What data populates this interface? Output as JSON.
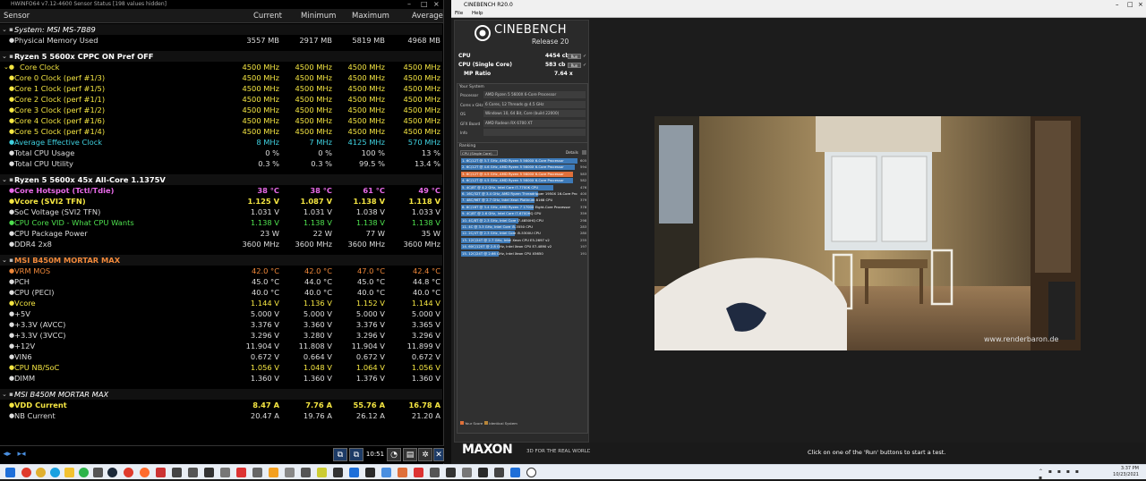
{
  "hwinfo": {
    "title": "HWiNFO64 v7.12-4600 Sensor Status [198 values hidden]",
    "columns": {
      "sensor": "Sensor",
      "current": "Current",
      "minimum": "Minimum",
      "maximum": "Maximum",
      "average": "Average"
    },
    "rows": [
      {
        "type": "group",
        "label": "System: MSI MS-7B89",
        "italic": true,
        "color": "#ffffff"
      },
      {
        "type": "row",
        "label": "Physical Memory Used",
        "cur": "3557 MB",
        "min": "2917 MB",
        "max": "5819 MB",
        "avg": "4968 MB",
        "color": "#dddddd"
      },
      {
        "type": "sep"
      },
      {
        "type": "group",
        "label": "Ryzen 5 5600x CPPC ON Pref OFF",
        "italic": false,
        "color": "#ffffff"
      },
      {
        "type": "row",
        "label": "Core Clock",
        "cur": "4500 MHz",
        "min": "4500 MHz",
        "max": "4500 MHz",
        "avg": "4500 MHz",
        "color": "#f5e642",
        "sub": true
      },
      {
        "type": "row",
        "label": "Core 0 Clock (perf #1/3)",
        "cur": "4500 MHz",
        "min": "4500 MHz",
        "max": "4500 MHz",
        "avg": "4500 MHz",
        "color": "#f5e642"
      },
      {
        "type": "row",
        "label": "Core 1 Clock (perf #1/5)",
        "cur": "4500 MHz",
        "min": "4500 MHz",
        "max": "4500 MHz",
        "avg": "4500 MHz",
        "color": "#f5e642"
      },
      {
        "type": "row",
        "label": "Core 2 Clock (perf #1/1)",
        "cur": "4500 MHz",
        "min": "4500 MHz",
        "max": "4500 MHz",
        "avg": "4500 MHz",
        "color": "#f5e642"
      },
      {
        "type": "row",
        "label": "Core 3 Clock (perf #1/2)",
        "cur": "4500 MHz",
        "min": "4500 MHz",
        "max": "4500 MHz",
        "avg": "4500 MHz",
        "color": "#f5e642"
      },
      {
        "type": "row",
        "label": "Core 4 Clock (perf #1/6)",
        "cur": "4500 MHz",
        "min": "4500 MHz",
        "max": "4500 MHz",
        "avg": "4500 MHz",
        "color": "#f5e642"
      },
      {
        "type": "row",
        "label": "Core 5 Clock (perf #1/4)",
        "cur": "4500 MHz",
        "min": "4500 MHz",
        "max": "4500 MHz",
        "avg": "4500 MHz",
        "color": "#f5e642"
      },
      {
        "type": "row",
        "label": "Average Effective Clock",
        "cur": "8 MHz",
        "min": "7 MHz",
        "max": "4125 MHz",
        "avg": "570 MHz",
        "color": "#3fd1e0"
      },
      {
        "type": "row",
        "label": "Total CPU Usage",
        "cur": "0 %",
        "min": "0 %",
        "max": "100 %",
        "avg": "13 %",
        "color": "#dddddd"
      },
      {
        "type": "row",
        "label": "Total CPU Utility",
        "cur": "0.3 %",
        "min": "0.3 %",
        "max": "99.5 %",
        "avg": "13.4 %",
        "color": "#dddddd"
      },
      {
        "type": "sep"
      },
      {
        "type": "group",
        "label": "Ryzen 5 5600x 45x All-Core 1.1375V",
        "italic": false,
        "color": "#ffffff"
      },
      {
        "type": "row",
        "label": "Core Hotspot (Tctl/Tdie)",
        "cur": "38 °C",
        "min": "38 °C",
        "max": "61 °C",
        "avg": "49 °C",
        "color": "#e86ae8",
        "bold": true
      },
      {
        "type": "row",
        "label": "Vcore (SVI2 TFN)",
        "cur": "1.125 V",
        "min": "1.087 V",
        "max": "1.138 V",
        "avg": "1.118 V",
        "color": "#f5e642",
        "bold": true
      },
      {
        "type": "row",
        "label": "SoC Voltage (SVI2 TFN)",
        "cur": "1.031 V",
        "min": "1.031 V",
        "max": "1.038 V",
        "avg": "1.033 V",
        "color": "#dddddd"
      },
      {
        "type": "row",
        "label": "CPU Core VID - What CPU Wants",
        "cur": "1.138 V",
        "min": "1.138 V",
        "max": "1.138 V",
        "avg": "1.138 V",
        "color": "#4ee04e"
      },
      {
        "type": "row",
        "label": "CPU Package Power",
        "cur": "23 W",
        "min": "22 W",
        "max": "77 W",
        "avg": "35 W",
        "color": "#dddddd"
      },
      {
        "type": "row",
        "label": "DDR4 2x8",
        "cur": "3600 MHz",
        "min": "3600 MHz",
        "max": "3600 MHz",
        "avg": "3600 MHz",
        "color": "#dddddd"
      },
      {
        "type": "sep"
      },
      {
        "type": "group",
        "label": "MSI B450M MORTAR MAX",
        "italic": false,
        "color": "#f0883a"
      },
      {
        "type": "row",
        "label": "VRM MOS",
        "cur": "42.0 °C",
        "min": "42.0 °C",
        "max": "47.0 °C",
        "avg": "42.4 °C",
        "color": "#f0883a"
      },
      {
        "type": "row",
        "label": "PCH",
        "cur": "45.0 °C",
        "min": "44.0 °C",
        "max": "45.0 °C",
        "avg": "44.8 °C",
        "color": "#dddddd"
      },
      {
        "type": "row",
        "label": "CPU (PECI)",
        "cur": "40.0 °C",
        "min": "40.0 °C",
        "max": "40.0 °C",
        "avg": "40.0 °C",
        "color": "#dddddd"
      },
      {
        "type": "row",
        "label": "Vcore",
        "cur": "1.144 V",
        "min": "1.136 V",
        "max": "1.152 V",
        "avg": "1.144 V",
        "color": "#f5e642"
      },
      {
        "type": "row",
        "label": "+5V",
        "cur": "5.000 V",
        "min": "5.000 V",
        "max": "5.000 V",
        "avg": "5.000 V",
        "color": "#dddddd"
      },
      {
        "type": "row",
        "label": "+3.3V (AVCC)",
        "cur": "3.376 V",
        "min": "3.360 V",
        "max": "3.376 V",
        "avg": "3.365 V",
        "color": "#dddddd"
      },
      {
        "type": "row",
        "label": "+3.3V (3VCC)",
        "cur": "3.296 V",
        "min": "3.280 V",
        "max": "3.296 V",
        "avg": "3.296 V",
        "color": "#dddddd"
      },
      {
        "type": "row",
        "label": "+12V",
        "cur": "11.904 V",
        "min": "11.808 V",
        "max": "11.904 V",
        "avg": "11.899 V",
        "color": "#dddddd"
      },
      {
        "type": "row",
        "label": "VIN6",
        "cur": "0.672 V",
        "min": "0.664 V",
        "max": "0.672 V",
        "avg": "0.672 V",
        "color": "#dddddd"
      },
      {
        "type": "row",
        "label": "CPU NB/SoC",
        "cur": "1.056 V",
        "min": "1.048 V",
        "max": "1.064 V",
        "avg": "1.056 V",
        "color": "#f5e642"
      },
      {
        "type": "row",
        "label": "DIMM",
        "cur": "1.360 V",
        "min": "1.360 V",
        "max": "1.376 V",
        "avg": "1.360 V",
        "color": "#dddddd"
      },
      {
        "type": "sep"
      },
      {
        "type": "group",
        "label": "MSI B450M MORTAR MAX",
        "italic": true,
        "color": "#ffffff"
      },
      {
        "type": "row",
        "label": "VDD Current",
        "cur": "8.47 A",
        "min": "7.76 A",
        "max": "55.76 A",
        "avg": "16.78 A",
        "color": "#f5e642",
        "bold": true
      },
      {
        "type": "row",
        "label": "NB Current",
        "cur": "20.47 A",
        "min": "19.76 A",
        "max": "26.12 A",
        "avg": "21.20 A",
        "color": "#dddddd"
      }
    ],
    "toolbar": {
      "time": "10:51"
    }
  },
  "cinebench": {
    "title": "CINEBENCH R20.0",
    "menu": [
      "File",
      "Help"
    ],
    "logo_title": "CINEBENCH",
    "logo_sub": "Release 20",
    "scores": [
      {
        "label": "CPU",
        "value": "4454 cb",
        "btn": "Run"
      },
      {
        "label": "CPU (Single Core)",
        "value": "583 cb",
        "btn": "Run"
      },
      {
        "label": "MP Ratio",
        "value": "7.64 x",
        "btn": ""
      }
    ],
    "system_header": "Your System",
    "system": [
      {
        "label": "Processor",
        "value": "AMD Ryzen 5 5600X 6-Core Processor"
      },
      {
        "label": "Cores x GHz",
        "value": "6 Cores, 12 Threads @ 4.5 GHz"
      },
      {
        "label": "OS",
        "value": "Windows 10, 64 Bit, Core (build 22000)"
      },
      {
        "label": "GFX Board",
        "value": "AMD Radeon RX 6700 XT"
      },
      {
        "label": "Info",
        "value": ""
      }
    ],
    "ranking_header": "Ranking",
    "ranking_select": "CPU (Single Core)",
    "ranking_details": "Details",
    "ranking": [
      {
        "label": "1. 6C/12T @ 3.7 GHz, AMD Ryzen 5 5600X 6-Core Processor",
        "score": "605",
        "fill": 1.0,
        "mine": false
      },
      {
        "label": "2. 6C/12T @ 4.6 GHz, AMD Ryzen 5 5600X 6-Core Processor",
        "score": "594",
        "fill": 0.98,
        "mine": false
      },
      {
        "label": "3. 6C/12T @ 4.5 GHz, AMD Ryzen 5 5600X 6-Core Processor",
        "score": "583",
        "fill": 0.96,
        "mine": true
      },
      {
        "label": "4. 6C/12T @ 4.5 GHz, AMD Ryzen 5 5600X 6-Core Processor",
        "score": "582",
        "fill": 0.96,
        "mine": false
      },
      {
        "label": "5. 4C/8T @ 4.2 GHz, Intel Core i7-7700K CPU",
        "score": "476",
        "fill": 0.79,
        "mine": false
      },
      {
        "label": "6. 16C/32T @ 3.4 GHz, AMD Ryzen Threadripper 1950X 16-Core Pro",
        "score": "400",
        "fill": 0.66,
        "mine": false
      },
      {
        "label": "7. 48C/96T @ 2.7 GHz, Intel Xeon Platinum 8168 CPU",
        "score": "379",
        "fill": 0.63,
        "mine": false
      },
      {
        "label": "8. 8C/16T @ 3.4 GHz, AMD Ryzen 7 1700X Eight-Core Processor",
        "score": "378",
        "fill": 0.62,
        "mine": false
      },
      {
        "label": "9. 4C/8T @ 2.6 GHz, Intel Core i7-6700HQ CPU",
        "score": "359",
        "fill": 0.59,
        "mine": false
      },
      {
        "label": "10. 4C/8T @ 2.3 GHz, Intel Core i7-4850HQ CPU",
        "score": "298",
        "fill": 0.49,
        "mine": false
      },
      {
        "label": "11. 4C @ 3.3 GHz, Intel Core i5-3550 CPU",
        "score": "283",
        "fill": 0.47,
        "mine": false
      },
      {
        "label": "12. 2C/4T @ 2.3 GHz, Intel Core i5-5300U CPU",
        "score": "280",
        "fill": 0.46,
        "mine": false
      },
      {
        "label": "13. 12C/24T @ 2.7 GHz, Intel Xeon CPU E5-2697 v2",
        "score": "255",
        "fill": 0.42,
        "mine": false
      },
      {
        "label": "14. 60C/120T @ 2.8 GHz, Intel Xeon CPU E7-4890 v2",
        "score": "197",
        "fill": 0.33,
        "mine": false
      },
      {
        "label": "15. 12C/24T @ 2.66 GHz, Intel Xeon CPU X5650",
        "score": "191",
        "fill": 0.32,
        "mine": false
      }
    ],
    "legend": [
      "Your Score",
      "Identical System"
    ],
    "maxon": "MAXON",
    "maxon_tag": "3D FOR THE REAL WORLD",
    "watermark": "www.renderbaron.de",
    "status": "Click on one of the 'Run' buttons to start a test."
  },
  "taskbar": {
    "time": "3:37 PM",
    "date": "10/23/2021"
  }
}
